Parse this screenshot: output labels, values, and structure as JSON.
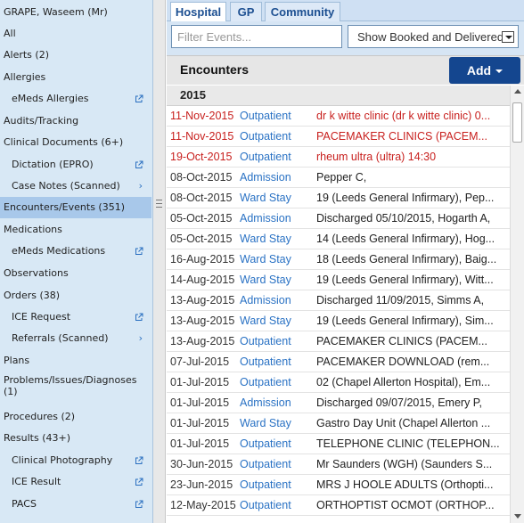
{
  "sidebar": {
    "patient_name": "GRAPE, Waseem (Mr)",
    "items": [
      {
        "label": "All"
      },
      {
        "label": "Alerts (2)"
      },
      {
        "label": "Allergies"
      },
      {
        "label": "eMeds Allergies",
        "icon": "external-link-icon"
      },
      {
        "label": "Audits/Tracking"
      },
      {
        "label": "Clinical Documents (6+)"
      },
      {
        "label": "Dictation (EPRO)",
        "icon": "external-link-icon"
      },
      {
        "label": "Case Notes (Scanned)",
        "icon": "chevron-right-icon"
      },
      {
        "label": "Encounters/Events (351)",
        "selected": true
      },
      {
        "label": "Medications"
      },
      {
        "label": "eMeds Medications",
        "icon": "external-link-icon"
      },
      {
        "label": "Observations"
      },
      {
        "label": "Orders (38)"
      },
      {
        "label": "ICE Request",
        "icon": "external-link-icon"
      },
      {
        "label": "Referrals (Scanned)",
        "icon": "chevron-right-icon"
      },
      {
        "label": "Plans"
      },
      {
        "label": "Problems/Issues/Diagnoses (1)"
      },
      {
        "label": "Procedures (2)"
      },
      {
        "label": "Results (43+)"
      },
      {
        "label": "Clinical Photography",
        "icon": "external-link-icon"
      },
      {
        "label": "ICE Result",
        "icon": "external-link-icon"
      },
      {
        "label": "PACS",
        "icon": "external-link-icon"
      }
    ]
  },
  "tabs": [
    {
      "label": "Hospital",
      "active": true
    },
    {
      "label": "GP"
    },
    {
      "label": "Community"
    }
  ],
  "filter": {
    "placeholder": "Filter Events...",
    "status_value": "Show Booked and Delivered"
  },
  "section": {
    "title": "Encounters",
    "add_label": "Add"
  },
  "year_group": "2015",
  "encounters": [
    {
      "date": "11-Nov-2015",
      "type": "Outpatient",
      "desc": "dr k witte clinic (dr k witte clinic) 0...",
      "highlight": true
    },
    {
      "date": "11-Nov-2015",
      "type": "Outpatient",
      "desc": "PACEMAKER CLINICS (PACEM...",
      "highlight": true
    },
    {
      "date": "19-Oct-2015",
      "type": "Outpatient",
      "desc": "rheum ultra (ultra) 14:30",
      "highlight": true
    },
    {
      "date": "08-Oct-2015",
      "type": "Admission",
      "desc": "Pepper C,"
    },
    {
      "date": "08-Oct-2015",
      "type": "Ward Stay",
      "desc": "19 (Leeds General Infirmary), Pep..."
    },
    {
      "date": "05-Oct-2015",
      "type": "Admission",
      "desc": "Discharged 05/10/2015, Hogarth A,"
    },
    {
      "date": "05-Oct-2015",
      "type": "Ward Stay",
      "desc": "14 (Leeds General Infirmary), Hog..."
    },
    {
      "date": "16-Aug-2015",
      "type": "Ward Stay",
      "desc": "18 (Leeds General Infirmary), Baig..."
    },
    {
      "date": "14-Aug-2015",
      "type": "Ward Stay",
      "desc": "19 (Leeds General Infirmary), Witt..."
    },
    {
      "date": "13-Aug-2015",
      "type": "Admission",
      "desc": "Discharged 11/09/2015, Simms A,"
    },
    {
      "date": "13-Aug-2015",
      "type": "Ward Stay",
      "desc": "19 (Leeds General Infirmary), Sim..."
    },
    {
      "date": "13-Aug-2015",
      "type": "Outpatient",
      "desc": "PACEMAKER CLINICS (PACEM..."
    },
    {
      "date": "07-Jul-2015",
      "type": "Outpatient",
      "desc": "PACEMAKER DOWNLOAD (rem..."
    },
    {
      "date": "01-Jul-2015",
      "type": "Outpatient",
      "desc": "02 (Chapel Allerton Hospital), Em..."
    },
    {
      "date": "01-Jul-2015",
      "type": "Admission",
      "desc": "Discharged 09/07/2015, Emery P,"
    },
    {
      "date": "01-Jul-2015",
      "type": "Ward Stay",
      "desc": "Gastro Day Unit (Chapel Allerton ..."
    },
    {
      "date": "01-Jul-2015",
      "type": "Outpatient",
      "desc": "TELEPHONE CLINIC (TELEPHON..."
    },
    {
      "date": "30-Jun-2015",
      "type": "Outpatient",
      "desc": "Mr Saunders (WGH) (Saunders S..."
    },
    {
      "date": "23-Jun-2015",
      "type": "Outpatient",
      "desc": "MRS J HOOLE ADULTS (Orthopti..."
    },
    {
      "date": "12-May-2015",
      "type": "Outpatient",
      "desc": "ORTHOPTIST OCMOT (ORTHOP..."
    }
  ]
}
